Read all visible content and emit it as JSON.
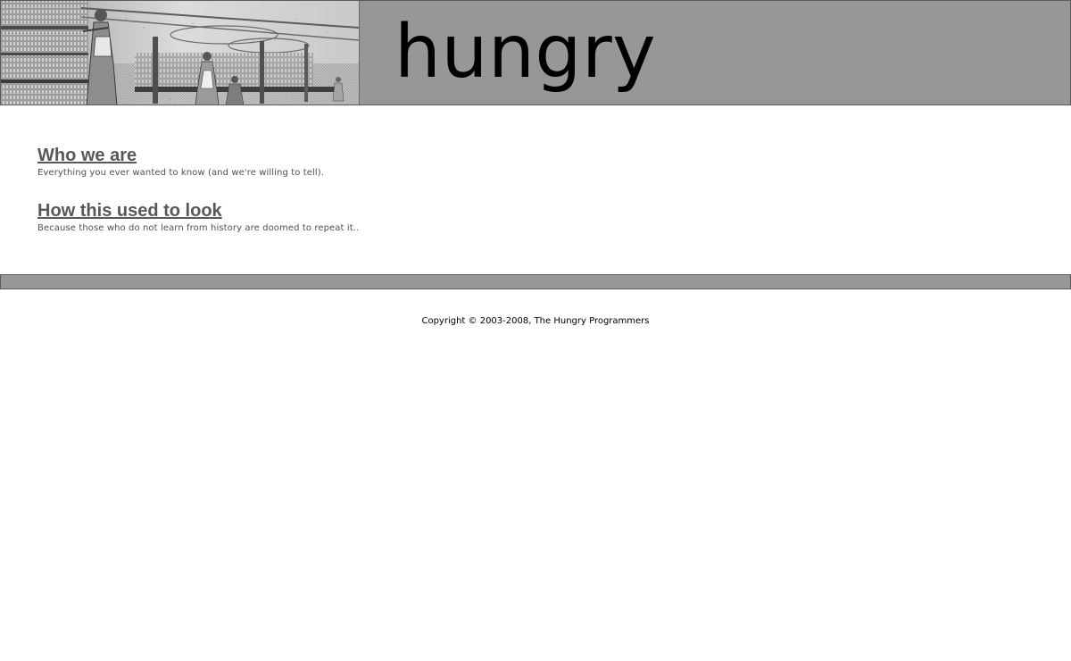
{
  "header": {
    "site_title": "hungry",
    "banner_image": "vintage-spinning-mill-engraving"
  },
  "main": {
    "entries": [
      {
        "title": "Who we are",
        "description": "Everything you ever wanted to know (and we're willing to tell)."
      },
      {
        "title": "How this used to look",
        "description": "Because those who do not learn from history are doomed to repeat it.."
      }
    ]
  },
  "footer": {
    "copyright": "Copyright © 2003-2008, The Hungry Programmers"
  },
  "colors": {
    "header_bg": "#979797",
    "link": "#585858",
    "description": "#505050"
  }
}
